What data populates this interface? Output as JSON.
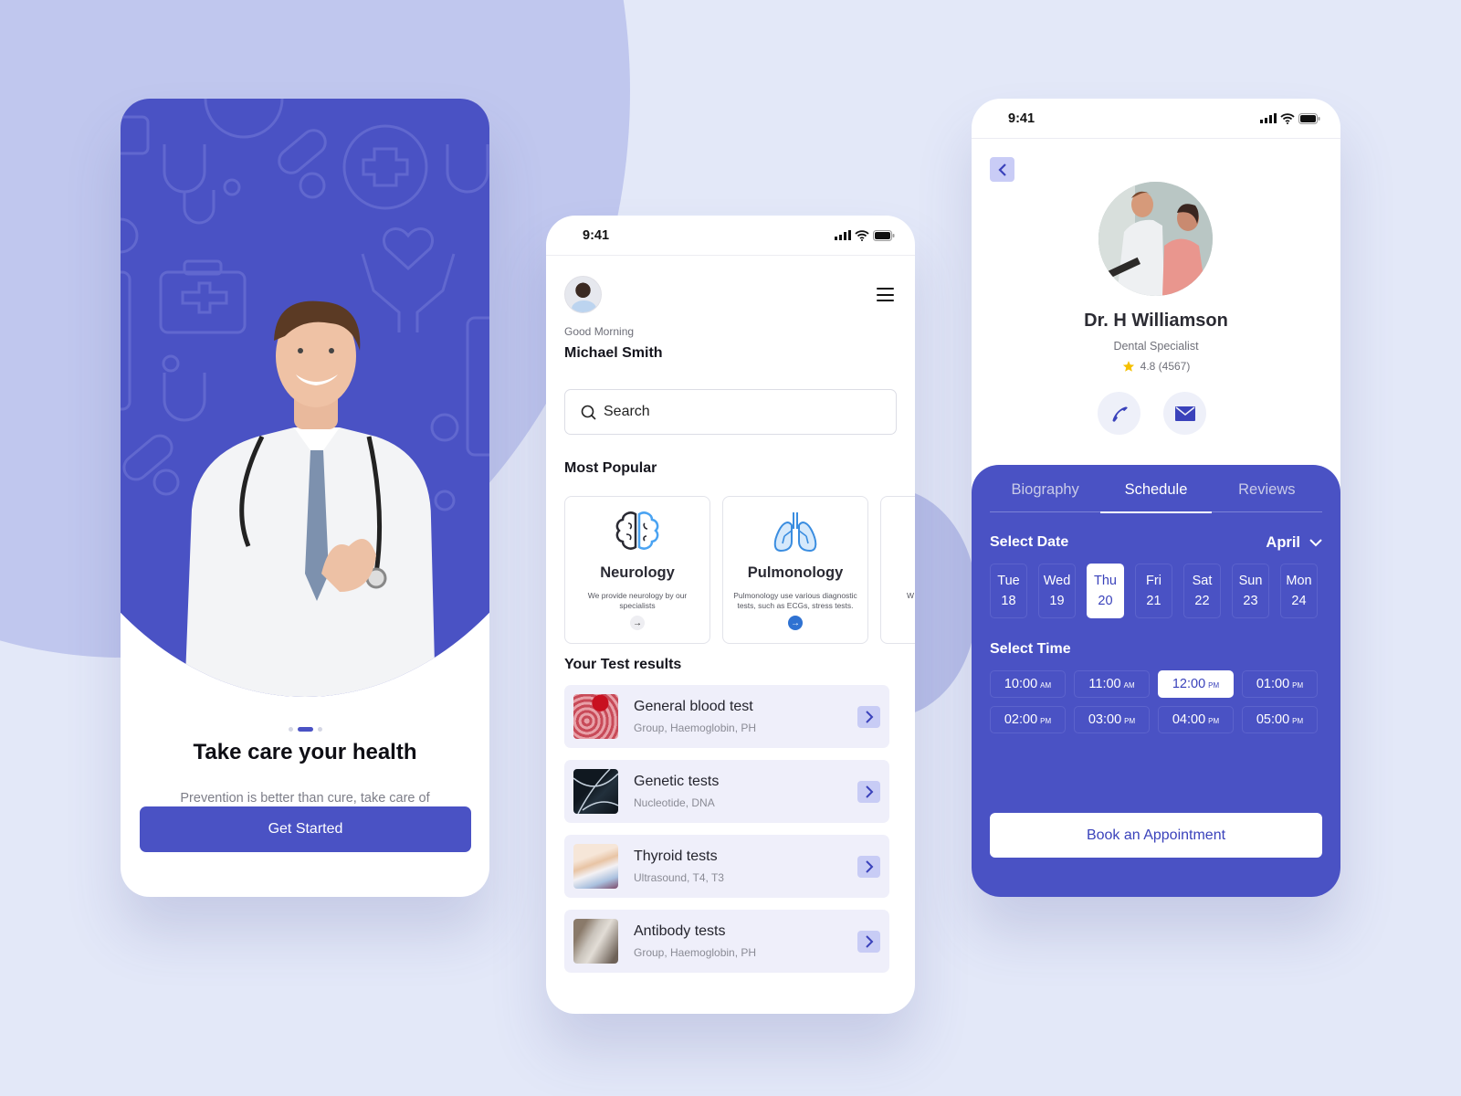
{
  "colors": {
    "primary": "#4a52c4",
    "accent_light": "#c9ccf6",
    "background": "#e3e8f8",
    "star": "#f5c000"
  },
  "onboarding": {
    "pager": {
      "count": 3,
      "active_index": 1
    },
    "title": "Take care your health",
    "subtitle": "Prevention is better than cure, take care of your family's health right now",
    "cta_label": "Get Started"
  },
  "home": {
    "status_time": "9:41",
    "greeting": "Good Morning",
    "user_name": "Michael Smith",
    "search_placeholder": "Search",
    "popular_title": "Most Popular",
    "popular": [
      {
        "name": "Neurology",
        "desc": "We provide neurology by our specialists",
        "icon": "brain-icon"
      },
      {
        "name": "Pulmonology",
        "desc": "Pulmonology use various diagnostic tests, such as ECGs, stress tests.",
        "icon": "lungs-icon"
      },
      {
        "name": "",
        "desc": "W",
        "icon": ""
      }
    ],
    "results_title": "Your Test results",
    "results": [
      {
        "title": "General blood test",
        "subtitle": "Group, Haemoglobin, PH"
      },
      {
        "title": "Genetic tests",
        "subtitle": "Nucleotide, DNA"
      },
      {
        "title": "Thyroid tests",
        "subtitle": "Ultrasound, T4, T3"
      },
      {
        "title": "Antibody tests",
        "subtitle": "Group, Haemoglobin, PH"
      }
    ]
  },
  "doctor": {
    "status_time": "9:41",
    "name": "Dr. H Williamson",
    "specialty": "Dental Specialist",
    "rating": "4.8 (4567)",
    "tabs": [
      "Biography",
      "Schedule",
      "Reviews"
    ],
    "active_tab": "Schedule",
    "select_date_label": "Select Date",
    "month": "April",
    "days": [
      {
        "dow": "Tue",
        "date": "18"
      },
      {
        "dow": "Wed",
        "date": "19"
      },
      {
        "dow": "Thu",
        "date": "20"
      },
      {
        "dow": "Fri",
        "date": "21"
      },
      {
        "dow": "Sat",
        "date": "22"
      },
      {
        "dow": "Sun",
        "date": "23"
      },
      {
        "dow": "Mon",
        "date": "24"
      }
    ],
    "selected_day": "20",
    "select_time_label": "Select Time",
    "times": [
      {
        "time": "10:00",
        "ampm": "AM"
      },
      {
        "time": "11:00",
        "ampm": "AM"
      },
      {
        "time": "12:00",
        "ampm": "PM"
      },
      {
        "time": "01:00",
        "ampm": "PM"
      },
      {
        "time": "02:00",
        "ampm": "PM"
      },
      {
        "time": "03:00",
        "ampm": "PM"
      },
      {
        "time": "04:00",
        "ampm": "PM"
      },
      {
        "time": "05:00",
        "ampm": "PM"
      }
    ],
    "selected_time": "12:00",
    "book_label": "Book an Appointment"
  }
}
